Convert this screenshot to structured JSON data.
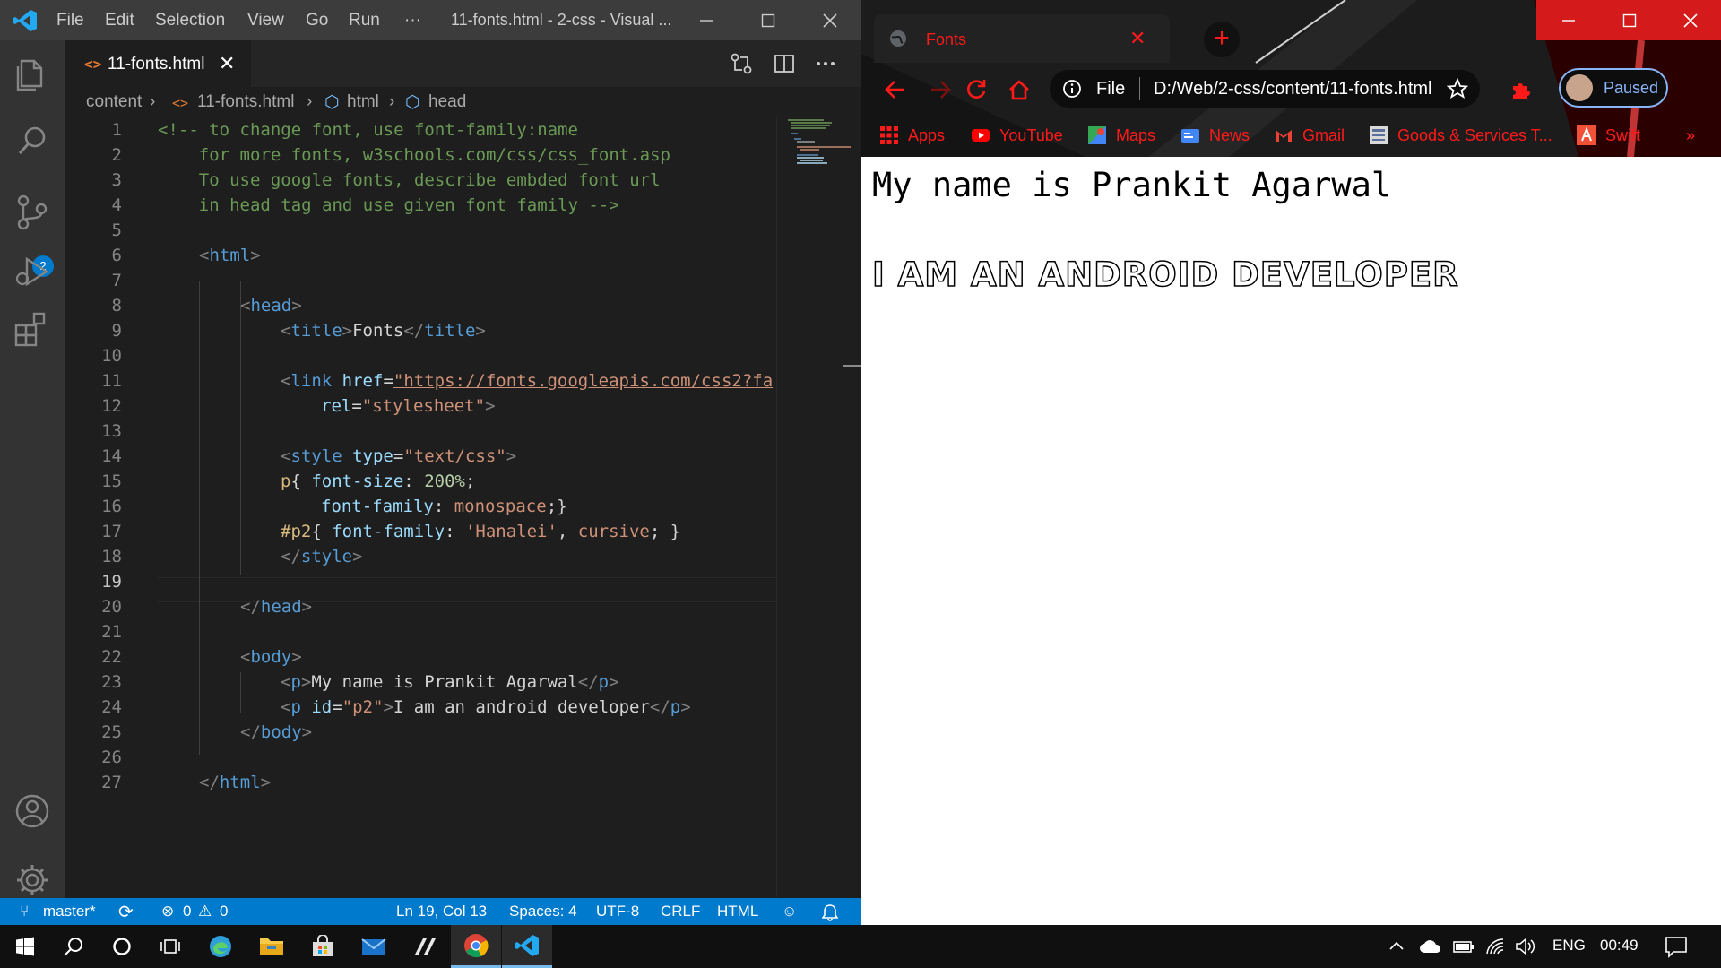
{
  "vscode": {
    "menu": [
      "File",
      "Edit",
      "Selection",
      "View",
      "Go",
      "Run",
      "···"
    ],
    "window_title": "11-fonts.html - 2-css - Visual ...",
    "tab": {
      "label": "11-fonts.html",
      "close": "✕"
    },
    "badge": "2",
    "breadcrumb": [
      "content",
      "11-fonts.html",
      "html",
      "head"
    ],
    "status": {
      "branch": "master*",
      "errors": "0",
      "warnings": "0",
      "position": "Ln 19, Col 13",
      "spaces": "Spaces: 4",
      "encoding": "UTF-8",
      "eol": "CRLF",
      "language": "HTML"
    },
    "line_numbers": [
      "1",
      "2",
      "3",
      "4",
      "5",
      "6",
      "7",
      "8",
      "9",
      "10",
      "11",
      "12",
      "13",
      "14",
      "15",
      "16",
      "17",
      "18",
      "19",
      "20",
      "21",
      "22",
      "23",
      "24",
      "25",
      "26",
      "27"
    ],
    "code": {
      "l1": "<!-- to change font, use font-family:name",
      "l2": "    for more fonts, w3schools.com/css/css_font.asp",
      "l3": "    To use google fonts, describe embded font url",
      "l4": "    in head tag and use given font family -->",
      "l6_tag": "html",
      "l8_tag": "head",
      "l9_tag": "title",
      "l9_text": "Fonts",
      "l11_tag": "link",
      "l11_attr": "href",
      "l11_url": "\"https://fonts.googleapis.com/css2?fa",
      "l12_attr": "rel",
      "l12_val": "\"stylesheet\"",
      "l14_tag": "style",
      "l14_attr": "type",
      "l14_val": "\"text/css\"",
      "l15_sel": "p",
      "l15_prop": "font-size",
      "l15_val": "200%",
      "l16_prop": "font-family",
      "l16_val": "monospace",
      "l17_sel": "#p2",
      "l17_prop": "font-family",
      "l17_val1": "'Hanalei'",
      "l17_val2": "cursive",
      "l18_tag": "style",
      "l20_tag": "head",
      "l22_tag": "body",
      "l23_tag": "p",
      "l23_text": "My name is Prankit Agarwal",
      "l24_tag": "p",
      "l24_attr": "id",
      "l24_val": "\"p2\"",
      "l24_text": "I am an android developer",
      "l25_tag": "body",
      "l27_tag": "html"
    }
  },
  "chrome": {
    "tab_title": "Fonts",
    "tab_close": "✕",
    "new_tab": "+",
    "address_scheme": "File",
    "address_url": "D:/Web/2-css/content/11-fonts.html",
    "profile_label": "Paused",
    "bookmarks": [
      "Apps",
      "YouTube",
      "Maps",
      "News",
      "Gmail",
      "Goods & Services T...",
      "Swift"
    ],
    "bookmarks_more": "»",
    "page": {
      "p1": "My name is Prankit Agarwal",
      "p2": "I AM AN ANDROID DEVELOPER"
    }
  },
  "taskbar": {
    "language": "ENG",
    "time": "00:49"
  },
  "colors": {
    "vscode_blue": "#007acc",
    "chrome_accent": "#ff1a1a",
    "titlebar_red": "#e81123"
  }
}
